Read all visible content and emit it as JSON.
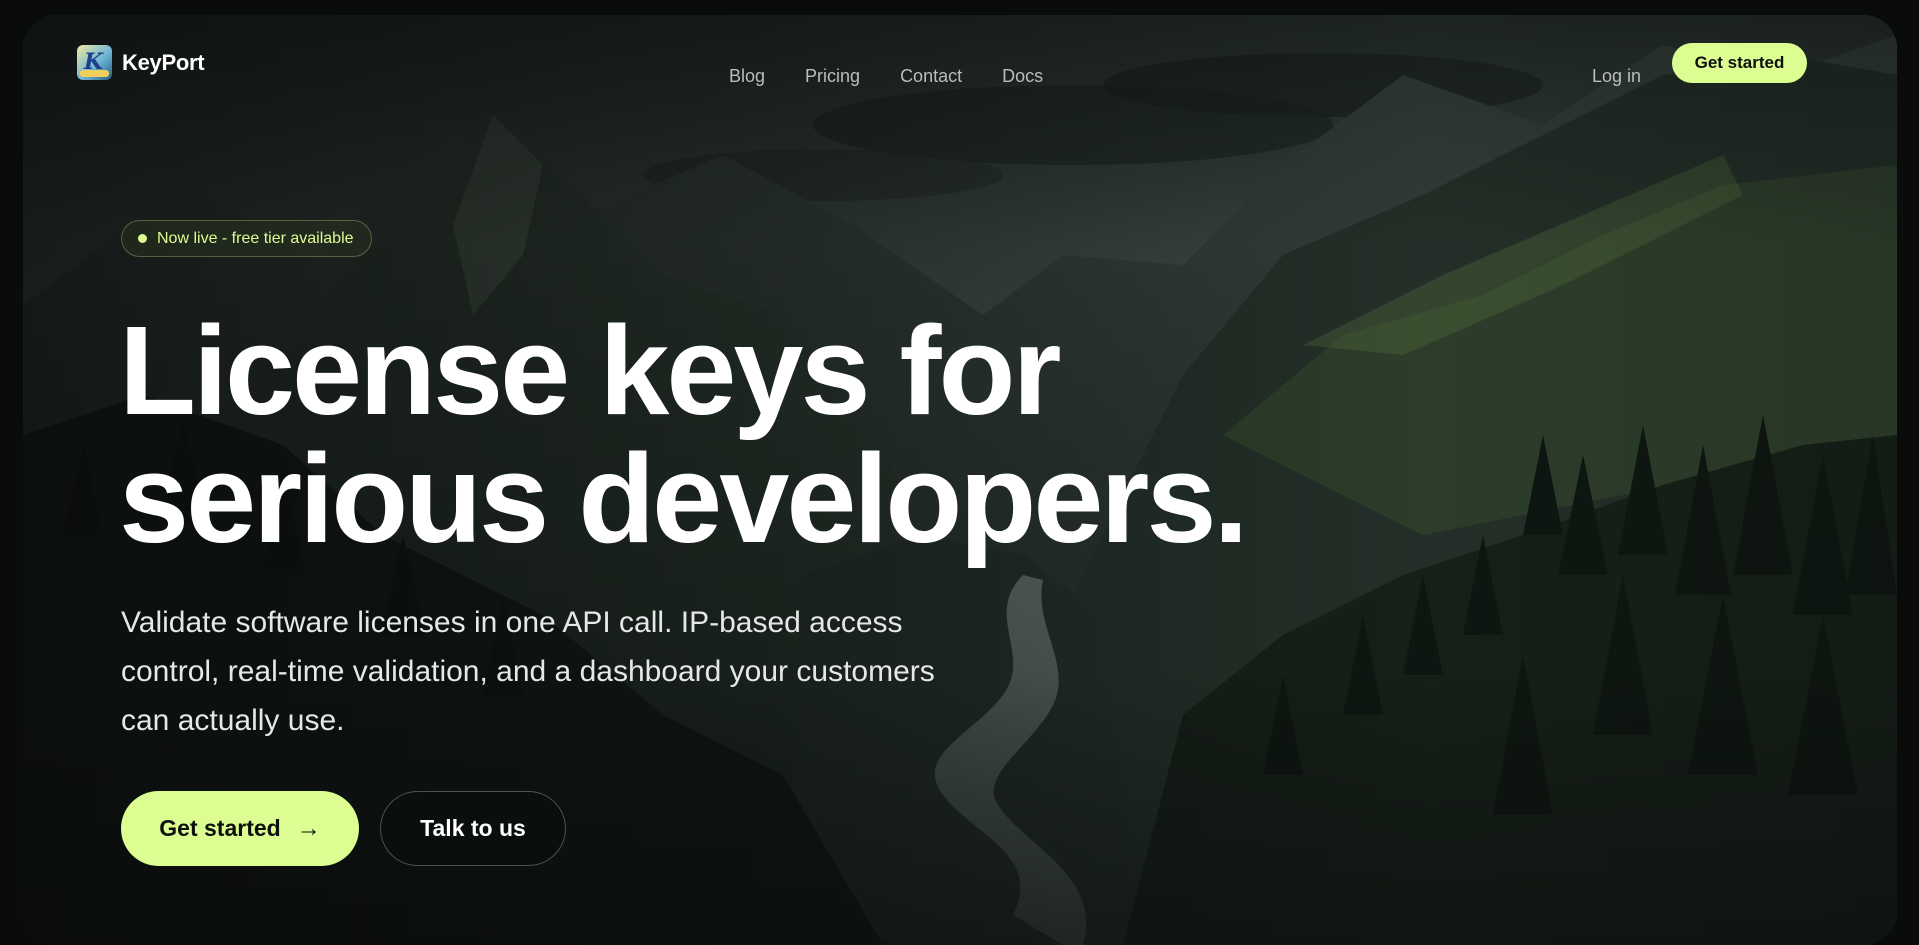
{
  "brand": {
    "name": "KeyPort",
    "logo_icon": "keyport-logo-icon"
  },
  "nav": {
    "links": [
      {
        "label": "Blog"
      },
      {
        "label": "Pricing"
      },
      {
        "label": "Contact"
      },
      {
        "label": "Docs"
      }
    ],
    "login_label": "Log in",
    "cta_label": "Get started"
  },
  "hero": {
    "badge": "Now live - free tier available",
    "headline_line1": "License keys for",
    "headline_line2": "serious developers.",
    "subheadline": "Validate software licenses in one API call. IP-based access control, real-time validation, and a dashboard your customers can actually use.",
    "primary_cta": "Get started",
    "primary_cta_icon": "arrow-right-icon",
    "secondary_cta": "Talk to us"
  },
  "colors": {
    "accent": "#dcfd92",
    "page_background": "#0a0b0b",
    "text_primary": "#ffffff",
    "text_muted": "#b9bdbc"
  }
}
